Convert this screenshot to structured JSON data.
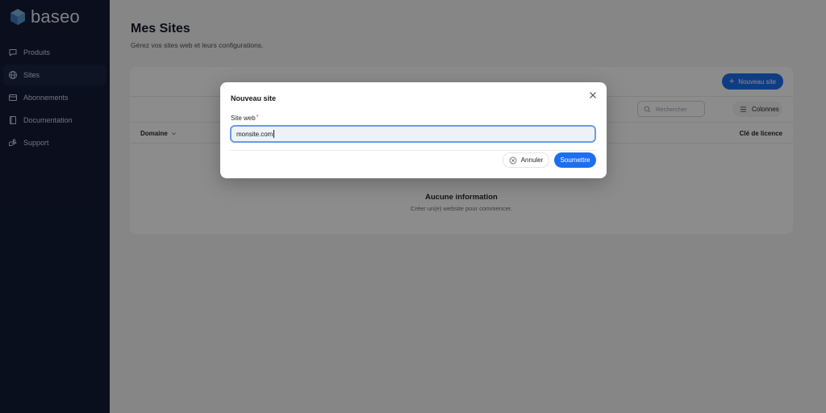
{
  "app": {
    "logo_text": "baseo"
  },
  "sidebar": {
    "items": [
      {
        "label": "Produits",
        "icon": "chat-bubble-icon",
        "active": false
      },
      {
        "label": "Sites",
        "icon": "globe-icon",
        "active": true
      },
      {
        "label": "Abonnements",
        "icon": "credit-card-icon",
        "active": false
      },
      {
        "label": "Documentation",
        "icon": "book-icon",
        "active": false
      },
      {
        "label": "Support",
        "icon": "support-hand-icon",
        "active": false
      }
    ]
  },
  "page": {
    "title": "Mes Sites",
    "subtitle": "Gérez vos sites web et leurs configurations."
  },
  "toolbar": {
    "new_site_label": "Nouveau site",
    "search_placeholder": "Rechercher",
    "columns_label": "Colonnes"
  },
  "table": {
    "columns": [
      "Domaine",
      "Clé de licence"
    ]
  },
  "empty_state": {
    "title": "Aucune information",
    "subtitle": "Créer un(e) website pour commencer."
  },
  "modal": {
    "title": "Nouveau site",
    "field_label": "Site web",
    "required_mark": "*",
    "field_value": "monsite.com",
    "cancel_label": "Annuler",
    "submit_label": "Soumettre"
  },
  "colors": {
    "sidebar_bg": "#131b36",
    "accent": "#1d6ff0",
    "required": "#e11d48"
  }
}
